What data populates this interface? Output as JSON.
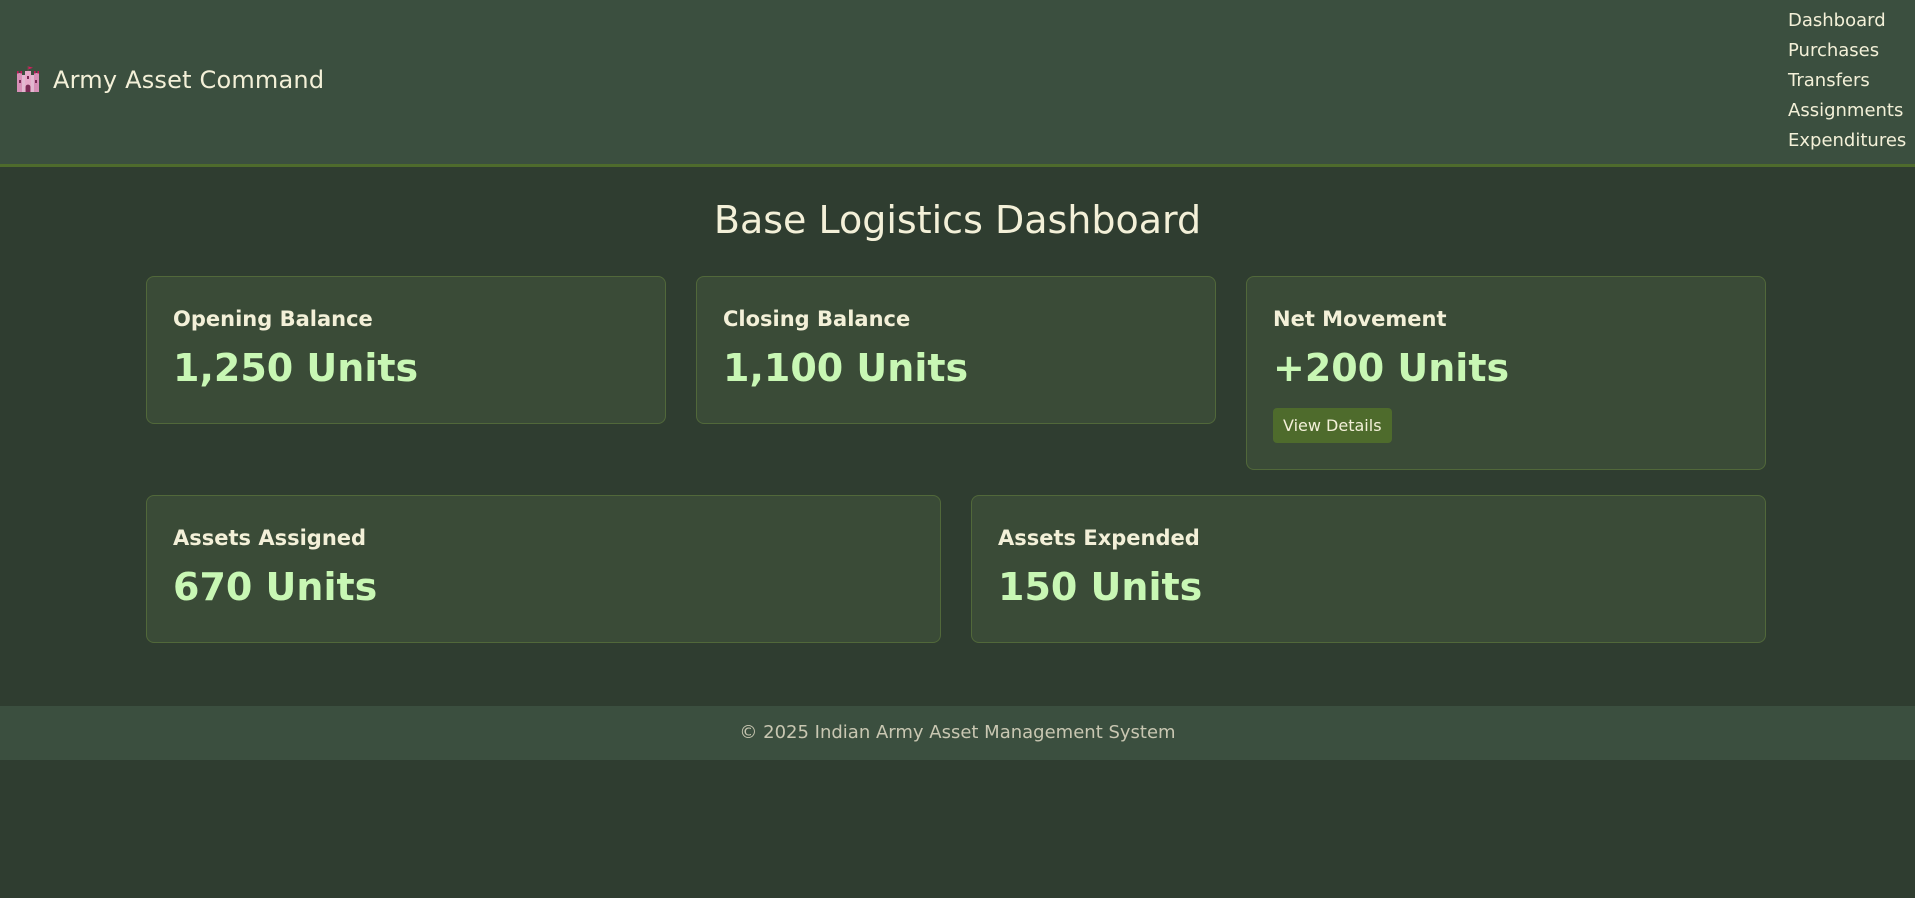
{
  "header": {
    "brand_icon": "castle-icon",
    "brand_title": "Army Asset Command",
    "nav": [
      {
        "label": "Dashboard"
      },
      {
        "label": "Purchases"
      },
      {
        "label": "Transfers"
      },
      {
        "label": "Assignments"
      },
      {
        "label": "Expenditures"
      }
    ]
  },
  "main": {
    "title": "Base Logistics Dashboard",
    "cards": [
      {
        "label": "Opening Balance",
        "value": "1,250 Units"
      },
      {
        "label": "Closing Balance",
        "value": "1,100 Units"
      },
      {
        "label": "Net Movement",
        "value": "+200 Units",
        "button_label": "View Details"
      },
      {
        "label": "Assets Assigned",
        "value": "670 Units"
      },
      {
        "label": "Assets Expended",
        "value": "150 Units"
      }
    ]
  },
  "footer": {
    "text": "© 2025 Indian Army Asset Management System"
  },
  "colors": {
    "page_background": "#2f3d30",
    "header_background": "#3b4f3f",
    "card_background": "#3a4b37",
    "card_border": "#51683a",
    "accent": "#4e6b2c",
    "value_text": "#c8f7b4",
    "primary_text": "#f3f0d8"
  }
}
